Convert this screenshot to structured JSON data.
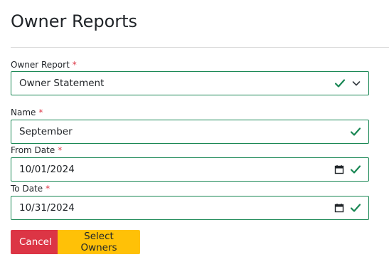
{
  "page": {
    "title": "Owner Reports"
  },
  "form": {
    "required_marker": "*",
    "owner_report": {
      "label": "Owner Report",
      "value": "Owner Statement"
    },
    "name": {
      "label": "Name",
      "value": "September"
    },
    "from_date": {
      "label": "From Date",
      "value": "10/01/2024"
    },
    "to_date": {
      "label": "To Date",
      "value": "10/31/2024"
    }
  },
  "buttons": {
    "cancel_label": "Cancel",
    "select_owners_label": "Select Owners"
  },
  "colors": {
    "valid_border": "#198754",
    "required": "#dc3545",
    "cancel_bg": "#dc3545",
    "select_bg": "#ffc107"
  },
  "icons": {
    "valid": "check-icon",
    "dropdown": "chevron-down-icon",
    "date": "calendar-icon"
  }
}
